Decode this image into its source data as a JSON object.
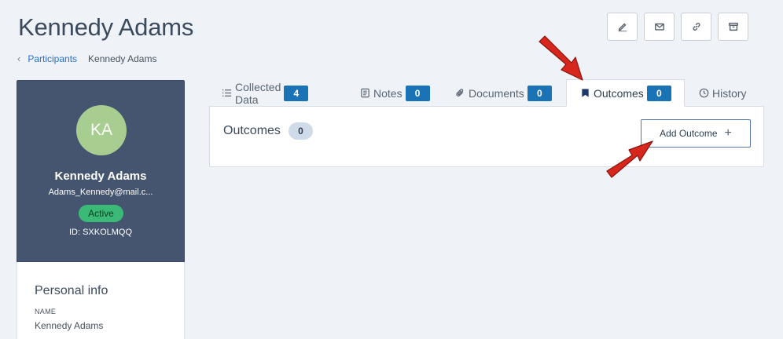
{
  "header": {
    "title": "Kennedy Adams",
    "breadcrumb": {
      "parent": "Participants",
      "current": "Kennedy Adams"
    },
    "toolbar": [
      {
        "name": "edit-icon"
      },
      {
        "name": "mail-icon"
      },
      {
        "name": "link-icon"
      },
      {
        "name": "archive-icon"
      }
    ]
  },
  "profile": {
    "initials": "KA",
    "name": "Kennedy Adams",
    "email": "Adams_Kennedy@mail.c...",
    "status": "Active",
    "id": "ID: SXKOLMQQ",
    "avatar_color": "#a7cd91",
    "card_color": "#45556f",
    "status_color": "#3bb977"
  },
  "personal_info": {
    "title": "Personal info",
    "name_label": "NAME",
    "name_value": "Kennedy Adams"
  },
  "tabs": [
    {
      "label": "Collected Data",
      "count": "4",
      "icon": "list-icon"
    },
    {
      "label": "Notes",
      "count": "0",
      "icon": "notes-icon"
    },
    {
      "label": "Documents",
      "count": "0",
      "icon": "paperclip-icon"
    },
    {
      "label": "Outcomes",
      "count": "0",
      "icon": "bookmark-icon",
      "active": true
    },
    {
      "label": "History",
      "icon": "clock-icon"
    }
  ],
  "outcomes": {
    "heading": "Outcomes",
    "count": "0",
    "add_button": "Add Outcome",
    "add_icon": "+"
  },
  "colors": {
    "accent": "#1a73b5",
    "link": "#2a6fc9",
    "annotation_arrow": "#d7261b"
  }
}
